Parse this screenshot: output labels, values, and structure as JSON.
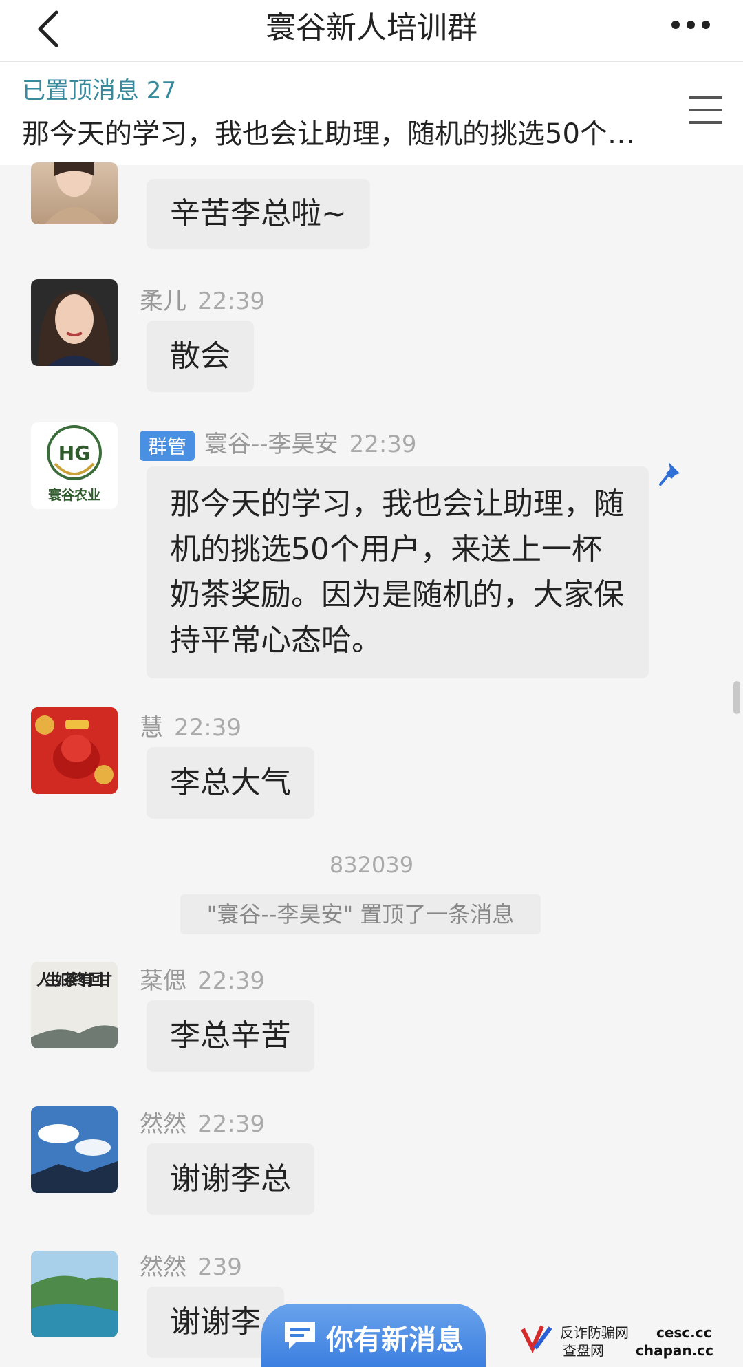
{
  "header": {
    "title": "寰谷新人培训群"
  },
  "pinned": {
    "label": "已置顶消息 27",
    "text": "那今天的学习，我也会让助理，随机的挑选50个…"
  },
  "messages": [
    {
      "sender": "",
      "time": "",
      "text": "辛苦李总啦~"
    },
    {
      "sender": "柔儿",
      "time": "22:39",
      "text": "散会"
    },
    {
      "badge": "群管",
      "sender": "寰谷--李昊安",
      "time": "22:39",
      "avatar_text": "HG",
      "avatar_caption": "寰谷农业",
      "text": "那今天的学习，我也会让助理，随机的挑选50个用户，来送上一杯奶茶奖励。因为是随机的，大家保持平常心态哈。"
    },
    {
      "sender": "慧",
      "time": "22:39",
      "text": "李总大气"
    },
    {
      "sender": "棻偲",
      "time": "22:39",
      "avatar_text": "人生如茶 终有回甘",
      "text": "李总辛苦"
    },
    {
      "sender": "然然",
      "time": "22:39",
      "text": "谢谢李总"
    },
    {
      "sender": "然然",
      "time": "239",
      "text": "谢谢李"
    }
  ],
  "system": {
    "number": "832039",
    "notice": "\"寰谷--李昊安\" 置顶了一条消息"
  },
  "new_message_button": {
    "label": "你有新消息"
  },
  "watermark": {
    "line1": "反诈防骗网",
    "line2": "查盘网",
    "site1": "cesc.cc",
    "site2": "chapan.cc"
  },
  "colors": {
    "badge": "#4a90e2",
    "pinned_label": "#3a8a9e",
    "bubble": "#ececec",
    "new_message": "#3b7fe0"
  }
}
